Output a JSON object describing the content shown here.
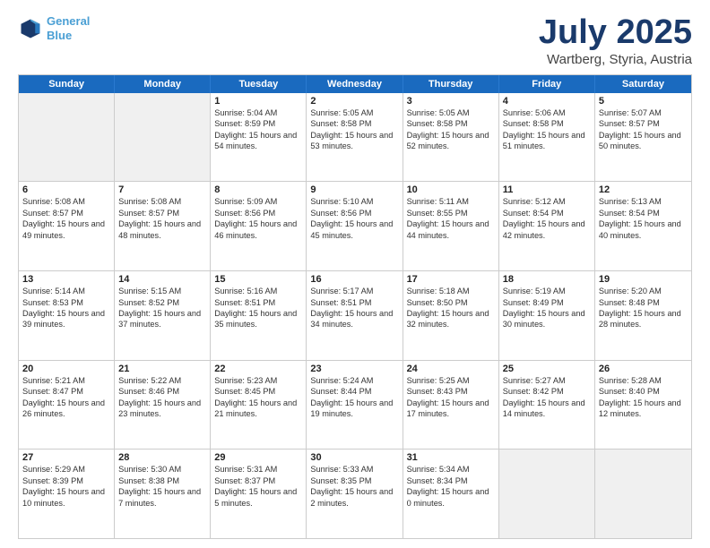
{
  "header": {
    "logo_line1": "General",
    "logo_line2": "Blue",
    "month": "July 2025",
    "location": "Wartberg, Styria, Austria"
  },
  "days_of_week": [
    "Sunday",
    "Monday",
    "Tuesday",
    "Wednesday",
    "Thursday",
    "Friday",
    "Saturday"
  ],
  "weeks": [
    [
      {
        "day": "",
        "sunrise": "",
        "sunset": "",
        "daylight": "",
        "shaded": true
      },
      {
        "day": "",
        "sunrise": "",
        "sunset": "",
        "daylight": "",
        "shaded": true
      },
      {
        "day": "1",
        "sunrise": "Sunrise: 5:04 AM",
        "sunset": "Sunset: 8:59 PM",
        "daylight": "Daylight: 15 hours and 54 minutes."
      },
      {
        "day": "2",
        "sunrise": "Sunrise: 5:05 AM",
        "sunset": "Sunset: 8:58 PM",
        "daylight": "Daylight: 15 hours and 53 minutes."
      },
      {
        "day": "3",
        "sunrise": "Sunrise: 5:05 AM",
        "sunset": "Sunset: 8:58 PM",
        "daylight": "Daylight: 15 hours and 52 minutes."
      },
      {
        "day": "4",
        "sunrise": "Sunrise: 5:06 AM",
        "sunset": "Sunset: 8:58 PM",
        "daylight": "Daylight: 15 hours and 51 minutes."
      },
      {
        "day": "5",
        "sunrise": "Sunrise: 5:07 AM",
        "sunset": "Sunset: 8:57 PM",
        "daylight": "Daylight: 15 hours and 50 minutes."
      }
    ],
    [
      {
        "day": "6",
        "sunrise": "Sunrise: 5:08 AM",
        "sunset": "Sunset: 8:57 PM",
        "daylight": "Daylight: 15 hours and 49 minutes."
      },
      {
        "day": "7",
        "sunrise": "Sunrise: 5:08 AM",
        "sunset": "Sunset: 8:57 PM",
        "daylight": "Daylight: 15 hours and 48 minutes."
      },
      {
        "day": "8",
        "sunrise": "Sunrise: 5:09 AM",
        "sunset": "Sunset: 8:56 PM",
        "daylight": "Daylight: 15 hours and 46 minutes."
      },
      {
        "day": "9",
        "sunrise": "Sunrise: 5:10 AM",
        "sunset": "Sunset: 8:56 PM",
        "daylight": "Daylight: 15 hours and 45 minutes."
      },
      {
        "day": "10",
        "sunrise": "Sunrise: 5:11 AM",
        "sunset": "Sunset: 8:55 PM",
        "daylight": "Daylight: 15 hours and 44 minutes."
      },
      {
        "day": "11",
        "sunrise": "Sunrise: 5:12 AM",
        "sunset": "Sunset: 8:54 PM",
        "daylight": "Daylight: 15 hours and 42 minutes."
      },
      {
        "day": "12",
        "sunrise": "Sunrise: 5:13 AM",
        "sunset": "Sunset: 8:54 PM",
        "daylight": "Daylight: 15 hours and 40 minutes."
      }
    ],
    [
      {
        "day": "13",
        "sunrise": "Sunrise: 5:14 AM",
        "sunset": "Sunset: 8:53 PM",
        "daylight": "Daylight: 15 hours and 39 minutes."
      },
      {
        "day": "14",
        "sunrise": "Sunrise: 5:15 AM",
        "sunset": "Sunset: 8:52 PM",
        "daylight": "Daylight: 15 hours and 37 minutes."
      },
      {
        "day": "15",
        "sunrise": "Sunrise: 5:16 AM",
        "sunset": "Sunset: 8:51 PM",
        "daylight": "Daylight: 15 hours and 35 minutes."
      },
      {
        "day": "16",
        "sunrise": "Sunrise: 5:17 AM",
        "sunset": "Sunset: 8:51 PM",
        "daylight": "Daylight: 15 hours and 34 minutes."
      },
      {
        "day": "17",
        "sunrise": "Sunrise: 5:18 AM",
        "sunset": "Sunset: 8:50 PM",
        "daylight": "Daylight: 15 hours and 32 minutes."
      },
      {
        "day": "18",
        "sunrise": "Sunrise: 5:19 AM",
        "sunset": "Sunset: 8:49 PM",
        "daylight": "Daylight: 15 hours and 30 minutes."
      },
      {
        "day": "19",
        "sunrise": "Sunrise: 5:20 AM",
        "sunset": "Sunset: 8:48 PM",
        "daylight": "Daylight: 15 hours and 28 minutes."
      }
    ],
    [
      {
        "day": "20",
        "sunrise": "Sunrise: 5:21 AM",
        "sunset": "Sunset: 8:47 PM",
        "daylight": "Daylight: 15 hours and 26 minutes."
      },
      {
        "day": "21",
        "sunrise": "Sunrise: 5:22 AM",
        "sunset": "Sunset: 8:46 PM",
        "daylight": "Daylight: 15 hours and 23 minutes."
      },
      {
        "day": "22",
        "sunrise": "Sunrise: 5:23 AM",
        "sunset": "Sunset: 8:45 PM",
        "daylight": "Daylight: 15 hours and 21 minutes."
      },
      {
        "day": "23",
        "sunrise": "Sunrise: 5:24 AM",
        "sunset": "Sunset: 8:44 PM",
        "daylight": "Daylight: 15 hours and 19 minutes."
      },
      {
        "day": "24",
        "sunrise": "Sunrise: 5:25 AM",
        "sunset": "Sunset: 8:43 PM",
        "daylight": "Daylight: 15 hours and 17 minutes."
      },
      {
        "day": "25",
        "sunrise": "Sunrise: 5:27 AM",
        "sunset": "Sunset: 8:42 PM",
        "daylight": "Daylight: 15 hours and 14 minutes."
      },
      {
        "day": "26",
        "sunrise": "Sunrise: 5:28 AM",
        "sunset": "Sunset: 8:40 PM",
        "daylight": "Daylight: 15 hours and 12 minutes."
      }
    ],
    [
      {
        "day": "27",
        "sunrise": "Sunrise: 5:29 AM",
        "sunset": "Sunset: 8:39 PM",
        "daylight": "Daylight: 15 hours and 10 minutes."
      },
      {
        "day": "28",
        "sunrise": "Sunrise: 5:30 AM",
        "sunset": "Sunset: 8:38 PM",
        "daylight": "Daylight: 15 hours and 7 minutes."
      },
      {
        "day": "29",
        "sunrise": "Sunrise: 5:31 AM",
        "sunset": "Sunset: 8:37 PM",
        "daylight": "Daylight: 15 hours and 5 minutes."
      },
      {
        "day": "30",
        "sunrise": "Sunrise: 5:33 AM",
        "sunset": "Sunset: 8:35 PM",
        "daylight": "Daylight: 15 hours and 2 minutes."
      },
      {
        "day": "31",
        "sunrise": "Sunrise: 5:34 AM",
        "sunset": "Sunset: 8:34 PM",
        "daylight": "Daylight: 15 hours and 0 minutes."
      },
      {
        "day": "",
        "sunrise": "",
        "sunset": "",
        "daylight": "",
        "shaded": true
      },
      {
        "day": "",
        "sunrise": "",
        "sunset": "",
        "daylight": "",
        "shaded": true
      }
    ]
  ]
}
